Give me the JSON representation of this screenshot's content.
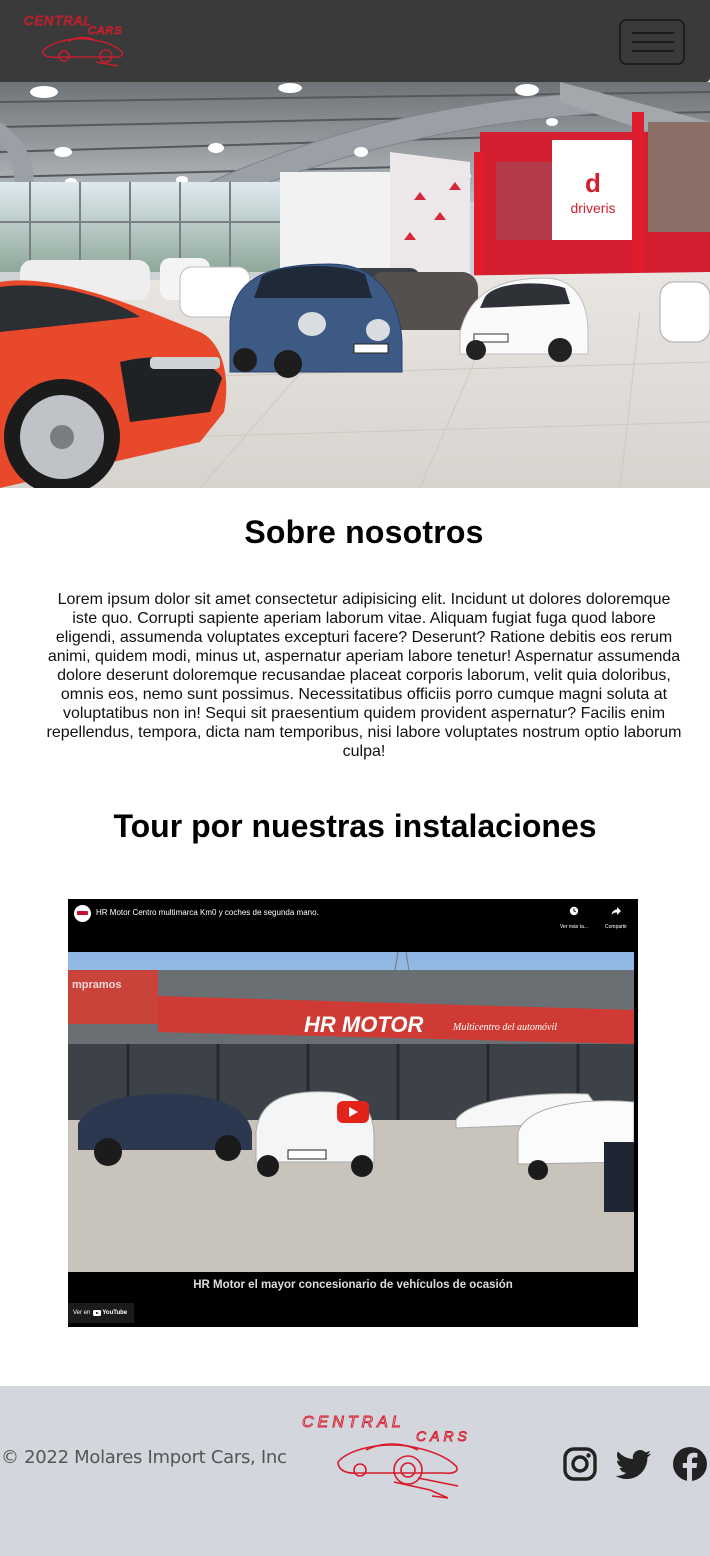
{
  "navbar": {
    "logo": {
      "icon": "central-cars-logo",
      "text_top": "CENTRAL",
      "text_bottom": "CARS",
      "color": "#d81b2c"
    },
    "menu_icon": "hamburger-menu-icon"
  },
  "hero": {
    "image_description_icon": "dealership-showroom-photo",
    "brand_sign": "driveris"
  },
  "about": {
    "title": "Sobre nosotros",
    "text": "Lorem ipsum dolor sit amet consectetur adipisicing elit. Incidunt ut dolores doloremque iste quo. Corrupti sapiente aperiam laborum vitae. Aliquam fugiat fuga quod labore eligendi, assumenda voluptates excepturi facere? Deserunt? Ratione debitis eos rerum animi, quidem modi, minus ut, aspernatur aperiam labore tenetur! Aspernatur assumenda dolore deserunt doloremque recusandae placeat corporis laborum, velit quia doloribus, omnis eos, nemo sunt possimus. Necessitatibus officiis porro cumque magni soluta at voluptatibus non in! Sequi sit praesentium quidem provident aspernatur? Facilis enim repellendus, tempora, dicta nam temporibus, nisi labore voluptates nostrum optio laborum culpa!"
  },
  "tour": {
    "title": "Tour por nuestras instalaciones",
    "video": {
      "title": "HR Motor Centro multimarca Km0 y coches de segunda mano.",
      "watch_later_label": "Ver más ta...",
      "share_label": "Compartir",
      "storefront_sign": "HR MOTOR",
      "storefront_sub": "Multicentro del automóvil",
      "caption": "HR Motor el mayor concesionario de vehículos de ocasión",
      "watch_on": "Ver en",
      "youtube": "YouTube"
    }
  },
  "footer": {
    "copyright": "© 2022 Molares Import Cars, Inc",
    "logo_text_top": "CENTRAL",
    "logo_text_bottom": "CARS",
    "social": [
      "instagram-icon",
      "twitter-icon",
      "facebook-icon"
    ]
  },
  "colors": {
    "navbar": "#3a3a3a",
    "brand_red": "#d81b2c",
    "footer": "#d3d6dc"
  }
}
